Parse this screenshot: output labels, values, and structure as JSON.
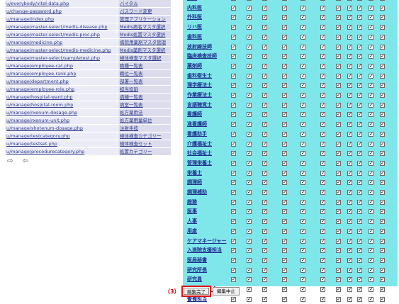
{
  "left_rows": [
    {
      "path": "u/everybody/vital-data.php",
      "name": "バイタル"
    },
    {
      "path": "u/change-password.php",
      "name": "パスワード変更"
    },
    {
      "path": "u/manage/index.php",
      "name": "管理アプリケーション"
    },
    {
      "path": "u/manage/master-select/medis-disease.php",
      "name": "Medis病名マスタ選択"
    },
    {
      "path": "u/manage/master-select/medis-proc.php",
      "name": "Medis処置マスタ選択"
    },
    {
      "path": "u/manage/medicine.php",
      "name": "病院用薬剤マスタ管理"
    },
    {
      "path": "u/manage/master-select/medis-medicine.php",
      "name": "Medis薬剤マスタ選択"
    },
    {
      "path": "u/manage/master-select/sampletest.php",
      "name": "検体検査マスタ選択"
    },
    {
      "path": "u/manage/employee-cat.php",
      "name": "職種一覧表"
    },
    {
      "path": "u/manage/employee-rank.php",
      "name": "職位一覧表"
    },
    {
      "path": "u/manage/department.php",
      "name": "部署一覧表"
    },
    {
      "path": "u/manage/employee-role.php",
      "name": "担当役割"
    },
    {
      "path": "u/manage/hospital-ward.php",
      "name": "病棟一覧表"
    },
    {
      "path": "u/manage/hospital-room.php",
      "name": "病室一覧表"
    },
    {
      "path": "u/manage/rxenum-dosage.php",
      "name": "処方薬用法"
    },
    {
      "path": "u/manage/rxenum-unit.php",
      "name": "処方薬用量単位"
    },
    {
      "path": "u/manage/shotenum-dosage.php",
      "name": "注射手技"
    },
    {
      "path": "u/manage/testcategory.php",
      "name": "検体検査カテゴリー"
    },
    {
      "path": "u/manage/testset.php",
      "name": "検体検査セット"
    },
    {
      "path": "u/manage/procedurecategory.php",
      "name": "処置カテゴリー"
    }
  ],
  "nav_arrows": {
    "next": "⇨",
    "prev": "⇦"
  },
  "roles": [
    "医師",
    "内科医",
    "外科医",
    "リハ医",
    "歯科医",
    "放射線技師",
    "臨床検査技師",
    "薬剤師",
    "歯科衛生士",
    "理学療法士",
    "作業療法士",
    "言語聴覚士",
    "看護師",
    "准看護師",
    "看護助手",
    "介護福祉士",
    "社会福祉士",
    "管理栄養士",
    "栄養士",
    "調理師",
    "調理補助",
    "総務",
    "医事",
    "人事",
    "用度",
    "ケアマネージャー",
    "入退院支援担当",
    "医局秘書",
    "研究所長",
    "研究員",
    "施設管理担当",
    "警備担当"
  ],
  "checkbox_columns": 11,
  "checked_glyph": "✓",
  "step_label": "（3）",
  "buttons": {
    "done": "編集完了",
    "cancel": "編集中止"
  },
  "colors": {
    "grid_bg": "#7fe6ea",
    "highlight": "#e01010"
  }
}
